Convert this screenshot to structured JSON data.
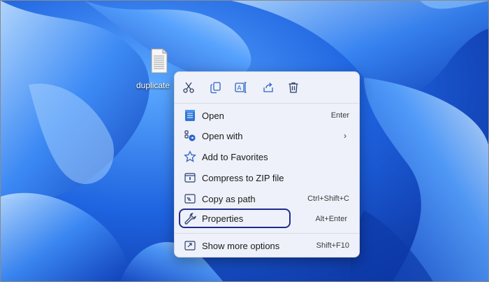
{
  "desktop": {
    "file_label": "duplicate"
  },
  "menu": {
    "actions": [
      {
        "icon": "cut-icon"
      },
      {
        "icon": "copy-icon"
      },
      {
        "icon": "rename-icon"
      },
      {
        "icon": "share-icon"
      },
      {
        "icon": "delete-icon"
      }
    ],
    "items": [
      {
        "label": "Open",
        "shortcut": "Enter",
        "icon": "notepad-icon"
      },
      {
        "label": "Open with",
        "shortcut": "",
        "icon": "open-with-icon",
        "submenu": true
      },
      {
        "label": "Add to Favorites",
        "shortcut": "",
        "icon": "star-icon"
      },
      {
        "label": "Compress to ZIP file",
        "shortcut": "",
        "icon": "zip-icon"
      },
      {
        "label": "Copy as path",
        "shortcut": "Ctrl+Shift+C",
        "icon": "copy-path-icon"
      },
      {
        "label": "Properties",
        "shortcut": "Alt+Enter",
        "icon": "wrench-icon"
      },
      {
        "label": "Show more options",
        "shortcut": "Shift+F10",
        "icon": "more-options-icon"
      }
    ]
  },
  "colors": {
    "highlight_border": "#1f2c8c",
    "accent": "#1a6fd6"
  }
}
